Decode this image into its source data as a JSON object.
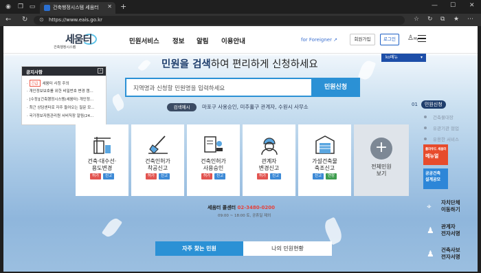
{
  "browser": {
    "tab_title": "건축행정시스템 세움터",
    "tab_close": "✕",
    "new_tab": "+",
    "url": "https://www.eais.go.kr",
    "win_min": "—",
    "win_max": "☐",
    "win_close": "✕"
  },
  "header": {
    "logo_main": "세움터",
    "logo_sub": "건축행정시스템",
    "menu": [
      "민원서비스",
      "정보",
      "알림",
      "이용안내"
    ],
    "foreigner": "for Foreigner ↗",
    "signup": "회원가입",
    "login": "로그인",
    "my": "My"
  },
  "hero": {
    "headline_bold": "민원을 검색",
    "headline_rest": "하여 편리하게 신청하세요",
    "language": "ko메뉴"
  },
  "search": {
    "placeholder": "지역명과 신청할 민원명을 입력하세요",
    "button": "민원신청",
    "example_tag": "검색예시",
    "example_text": "마포구 사용승인, 미추홀구 관계자, 수원시 사무소"
  },
  "notice": {
    "title": "공지사항",
    "more": "↗",
    "items": [
      {
        "badge": "긴급",
        "text": "세움터 사칭 주의"
      },
      {
        "badge": "",
        "text": "· 개인정보보호를 위한 비밀번호 변경 캠..."
      },
      {
        "badge": "",
        "text": "· [수정][건축행정시스템(세움터) 개인정..."
      },
      {
        "badge": "",
        "text": "· 최근 상담센터로 자주 들어오는 질문 모..."
      },
      {
        "badge": "",
        "text": "· 국가정보자원관리원 서비직장 알림(24..."
      }
    ]
  },
  "cards": [
    {
      "line1": "건축·대수선·",
      "line2": "용도변경",
      "tags": [
        "허가",
        "신고"
      ]
    },
    {
      "line1": "건축인허가",
      "line2": "착공신고",
      "tags": [
        "허가",
        "신고"
      ]
    },
    {
      "line1": "건축인허가",
      "line2": "사용승인",
      "tags": [
        "허가",
        "신고"
      ]
    },
    {
      "line1": "관계자",
      "line2": "변경신고",
      "tags": [
        "허가",
        "신고"
      ]
    },
    {
      "line1": "가설건축물",
      "line2": "축조신고",
      "tags": [
        "신고",
        "연장"
      ]
    }
  ],
  "all_cards": {
    "line1": "전체민원",
    "line2": "보기",
    "icon": "+"
  },
  "callcenter": {
    "label": "세움터 콜센터",
    "number": "02-3480-0200",
    "hours": "09:00 ~ 18:00 토, 공휴일 제외"
  },
  "bottom_tabs": {
    "active": "자주 찾는 민원",
    "inactive": "나의 민원현황"
  },
  "quicknav": {
    "num": "01",
    "active": "민원신청",
    "items": [
      "건축물대장",
      "유관기관 협업",
      "유용한 서비스"
    ]
  },
  "banners": [
    {
      "line1": "플라우드 세움터",
      "line2": "메뉴얼"
    },
    {
      "line1": "공공건축",
      "line2": "설계공모"
    }
  ],
  "side_links": [
    {
      "line1": "자치단체",
      "line2": "이동하기"
    },
    {
      "line1": "관계자",
      "line2": "전자서명"
    },
    {
      "line1": "건축사보",
      "line2": "전자서명"
    }
  ],
  "colors": {
    "accent": "#2b91d5",
    "navy": "#1f3e6c",
    "red_tag": "#e25450",
    "blue_tag": "#3d8ad6",
    "green_tag": "#3e9d4e"
  }
}
